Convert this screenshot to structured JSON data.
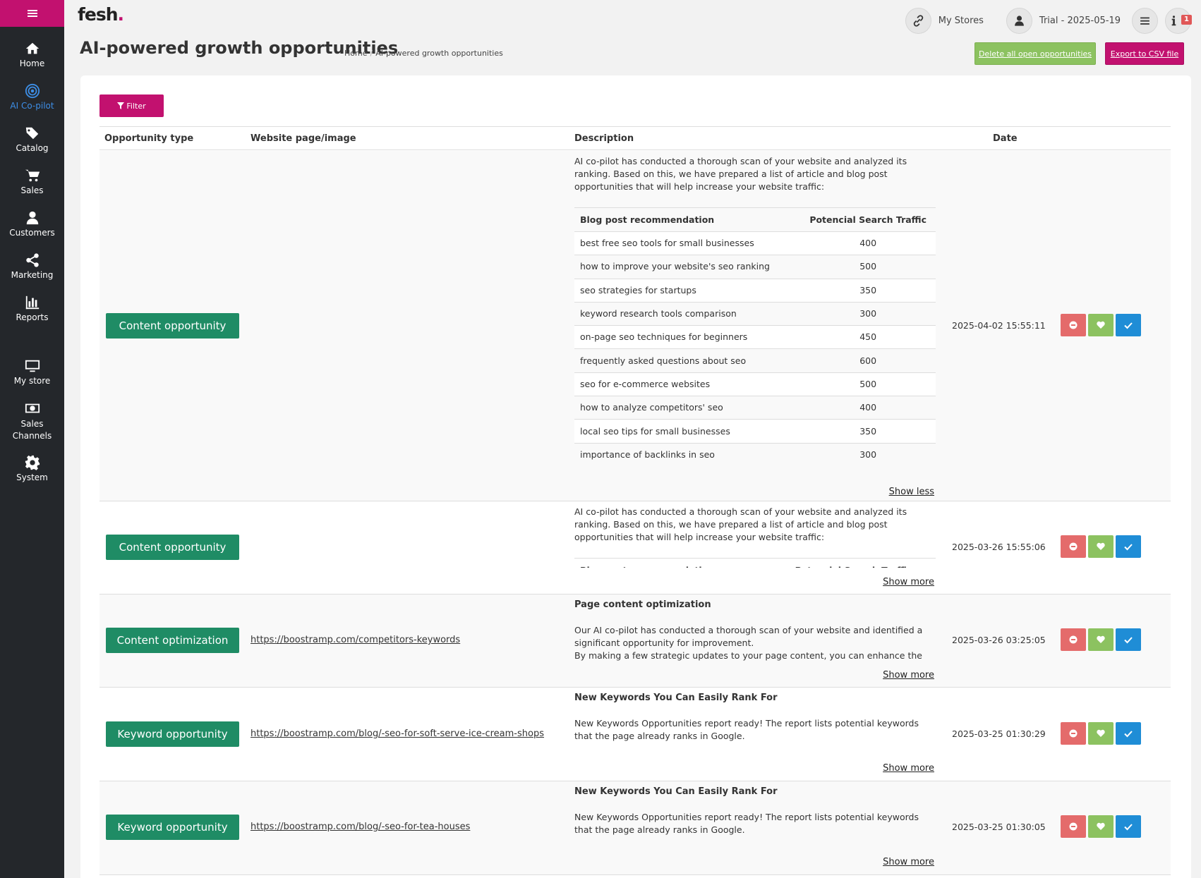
{
  "brand": {
    "logo_text": "fesh",
    "logo_dot": "."
  },
  "sidebar": {
    "items": [
      {
        "label": "Home",
        "icon": "home-icon"
      },
      {
        "label": "AI Co-pilot",
        "icon": "ai-copilot-icon",
        "active": true
      },
      {
        "label": "Catalog",
        "icon": "tags-icon"
      },
      {
        "label": "Sales",
        "icon": "cart-icon"
      },
      {
        "label": "Customers",
        "icon": "user-icon"
      },
      {
        "label": "Marketing",
        "icon": "share-icon"
      },
      {
        "label": "Reports",
        "icon": "bar-chart-icon"
      },
      {
        "label": "My store",
        "icon": "monitor-icon"
      },
      {
        "label": "Sales Channels",
        "icon": "money-icon"
      },
      {
        "label": "System",
        "icon": "gear-icon"
      }
    ]
  },
  "topbar": {
    "stores_label": "My Stores",
    "account_label": "Trial - 2025-05-19",
    "notification_count": "1"
  },
  "page": {
    "title": "AI-powered growth opportunities",
    "breadcrumb": [
      "Home",
      "AI-powered growth opportunities"
    ],
    "delete_all_label": "Delete all open opportunities",
    "export_label": "Export to CSV file",
    "filter_label": "Filter"
  },
  "table": {
    "headers": [
      "Opportunity type",
      "Website page/image",
      "Description",
      "Date"
    ],
    "rows": [
      {
        "type": "Content opportunity",
        "url": "",
        "intro": "AI co-pilot has conducted a thorough scan of your website and analyzed its ranking. Based on this, we have prepared a list of article and blog post opportunities that will help increase your website traffic:",
        "rec_headers": [
          "Blog post recommendation",
          "Potencial Search Traffic"
        ],
        "recommendations": [
          {
            "topic": "best free seo tools for small businesses",
            "traffic": "400"
          },
          {
            "topic": "how to improve your website's seo ranking",
            "traffic": "500"
          },
          {
            "topic": "seo strategies for startups",
            "traffic": "350"
          },
          {
            "topic": "keyword research tools comparison",
            "traffic": "300"
          },
          {
            "topic": "on-page seo techniques for beginners",
            "traffic": "450"
          },
          {
            "topic": "frequently asked questions about seo",
            "traffic": "600"
          },
          {
            "topic": "seo for e-commerce websites",
            "traffic": "500"
          },
          {
            "topic": "how to analyze competitors' seo",
            "traffic": "400"
          },
          {
            "topic": "local seo tips for small businesses",
            "traffic": "350"
          },
          {
            "topic": "importance of backlinks in seo",
            "traffic": "300"
          }
        ],
        "toggle": "Show less",
        "date": "2025-04-02 15:55:11"
      },
      {
        "type": "Content opportunity",
        "url": "",
        "intro": "AI co-pilot has conducted a thorough scan of your website and analyzed its ranking. Based on this, we have prepared a list of article and blog post opportunities that will help increase your website traffic:",
        "rec_headers": [
          "Blog post recommendation",
          "Potencial Search Traffic"
        ],
        "toggle": "Show more",
        "date": "2025-03-26 15:55:06"
      },
      {
        "type": "Content optimization",
        "url": "https://boostramp.com/competitors-keywords",
        "heading": "Page content optimization",
        "body": "Our AI co-pilot has conducted a thorough scan of your website and identified a significant opportunity for improvement.",
        "body2": "By making a few strategic updates to your page content, you can enhance the ranking",
        "toggle": "Show more",
        "date": "2025-03-26 03:25:05"
      },
      {
        "type": "Keyword opportunity",
        "url": "https://boostramp.com/blog/-seo-for-soft-serve-ice-cream-shops",
        "heading": "New Keywords You Can Easily Rank For",
        "body": "New Keywords Opportunities report ready! The report lists potential keywords that the page already ranks in Google.",
        "toggle": "Show more",
        "date": "2025-03-25 01:30:29"
      },
      {
        "type": "Keyword opportunity",
        "url": "https://boostramp.com/blog/-seo-for-tea-houses",
        "heading": "New Keywords You Can Easily Rank For",
        "body": "New Keywords Opportunities report ready! The report lists potential keywords that the page already ranks in Google.",
        "toggle": "Show more",
        "date": "2025-03-25 01:30:05"
      }
    ]
  },
  "colors": {
    "brand": "#c2116f",
    "sidebar_bg": "#24272b",
    "badge_green": "#1f8c65",
    "reject": "#e46b6b",
    "favorite": "#8cc260",
    "approve": "#1f8dd6",
    "active_nav": "#3d8ee6"
  }
}
